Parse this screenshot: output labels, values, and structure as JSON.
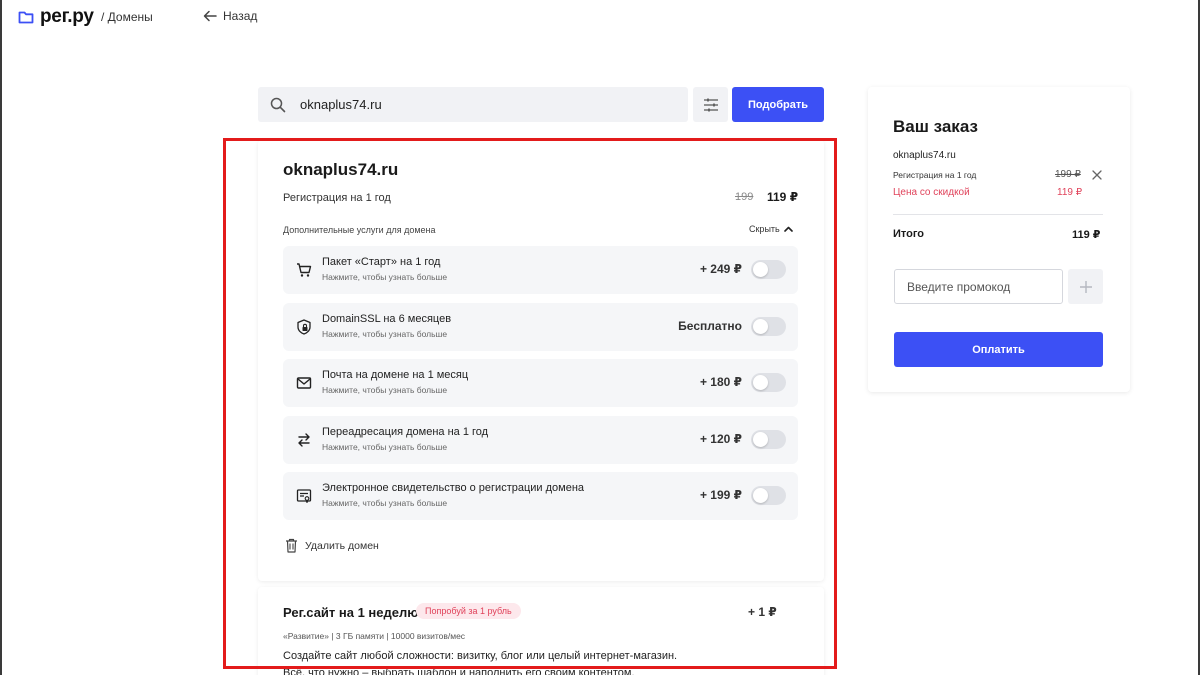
{
  "header": {
    "logo_text": "рег.ру",
    "breadcrumb": "/ Домены",
    "back_label": "Назад"
  },
  "search": {
    "value": "oknaplus74.ru",
    "submit_label": "Подобрать"
  },
  "domain_card": {
    "title": "oknaplus74.ru",
    "registration_label": "Регистрация на 1 год",
    "old_price": "199",
    "new_price": "119 ₽",
    "extra_services_label": "Дополнительные услуги для домена",
    "hide_label": "Скрыть",
    "services": [
      {
        "title": "Пакет «Старт» на 1 год",
        "subtitle": "Нажмите, чтобы узнать больше",
        "price": "+ 249 ₽",
        "icon": "cart-icon",
        "enabled": false
      },
      {
        "title": "DomainSSL на 6 месяцев",
        "subtitle": "Нажмите, чтобы узнать больше",
        "price": "Бесплатно",
        "icon": "ssl-shield-icon",
        "enabled": false
      },
      {
        "title": "Почта на домене на 1 месяц",
        "subtitle": "Нажмите, чтобы узнать больше",
        "price": "+ 180 ₽",
        "icon": "mail-icon",
        "enabled": false
      },
      {
        "title": "Переадресация домена на 1 год",
        "subtitle": "Нажмите, чтобы узнать больше",
        "price": "+ 120 ₽",
        "icon": "redirect-arrows-icon",
        "enabled": false
      },
      {
        "title": "Электронное свидетельство о регистрации домена",
        "subtitle": "Нажмите, чтобы узнать больше",
        "price": "+ 199 ₽",
        "icon": "certificate-icon",
        "enabled": false
      }
    ],
    "delete_label": "Удалить домен"
  },
  "site_card": {
    "title": "Рег.сайт на 1 неделю",
    "badge": "Попробуй за 1 рубль",
    "price": "+ 1 ₽",
    "details": "«Развитие» | 3 ГБ памяти | 10000 визитов/мес",
    "description_line1": "Создайте сайт любой сложности: визитку, блог или целый интернет-магазин.",
    "description_line2": "Всё, что нужно – выбрать шаблон и наполнить его своим контентом."
  },
  "order": {
    "title": "Ваш заказ",
    "domain": "oknaplus74.ru",
    "registration_label": "Регистрация на 1 год",
    "old_price": "199 ₽",
    "discount_label": "Цена со скидкой",
    "discount_price": "119 ₽",
    "total_label": "Итого",
    "total_value": "119 ₽",
    "promo_placeholder": "Введите промокод",
    "pay_label": "Оплатить"
  },
  "colors": {
    "accent": "#3c50f5",
    "discount": "#e0435b",
    "highlight": "#e31b1b"
  }
}
